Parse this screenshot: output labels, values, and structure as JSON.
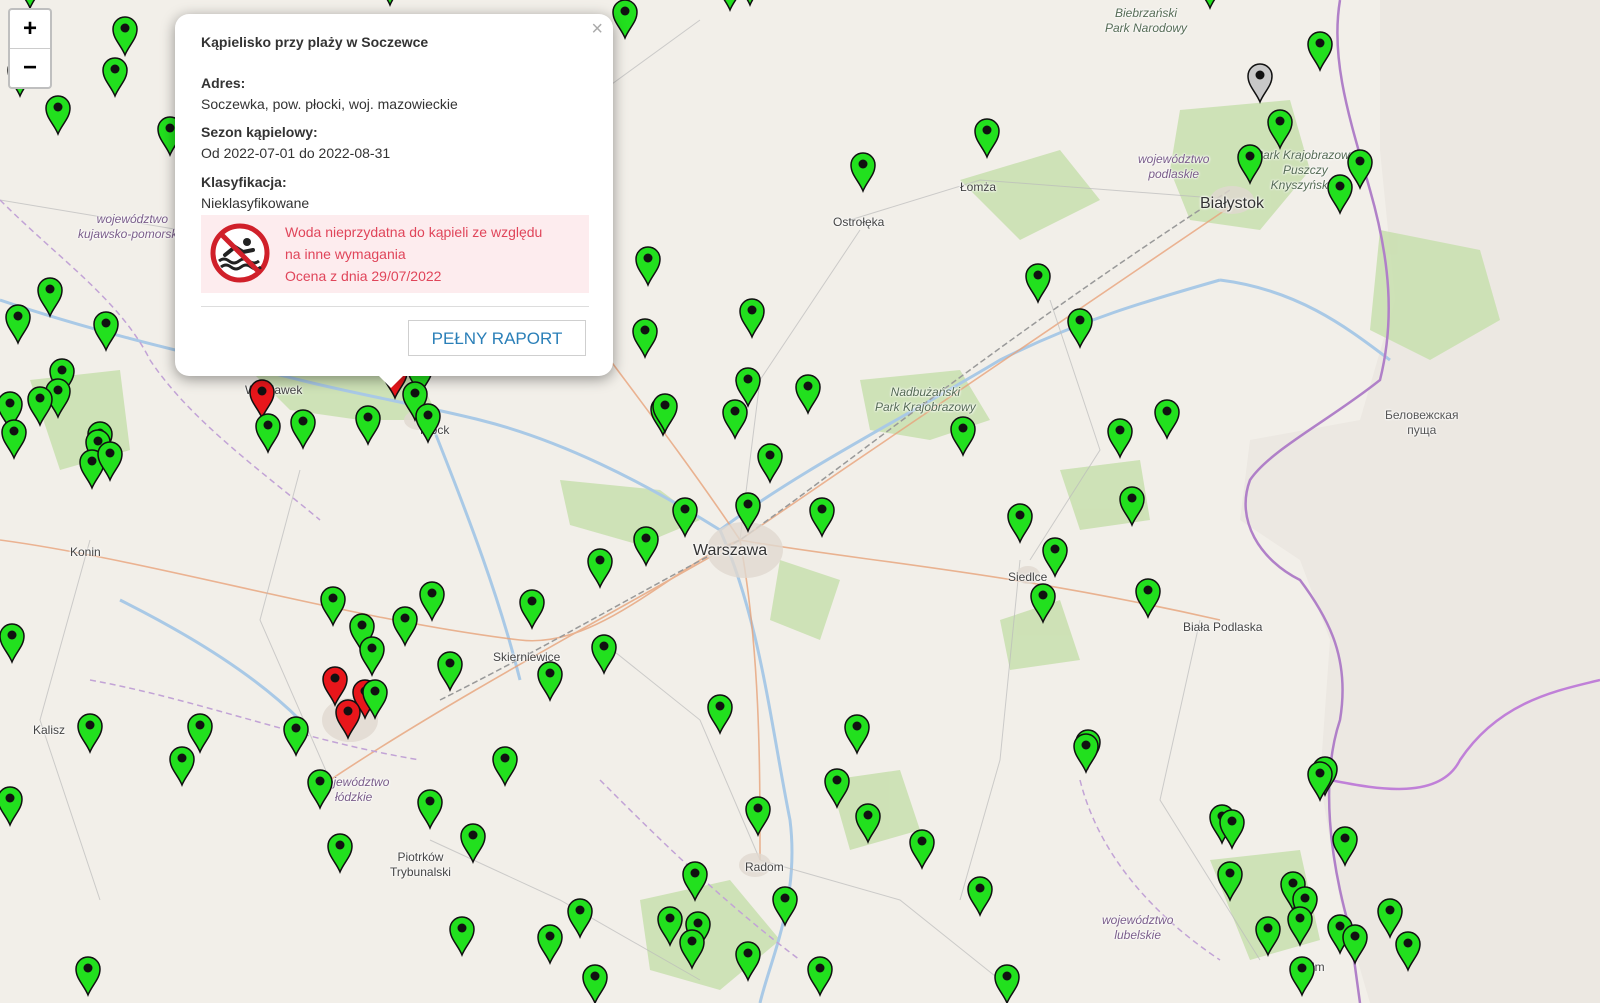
{
  "zoom": {
    "in_label": "+",
    "out_label": "−"
  },
  "popup": {
    "close_label": "×",
    "title": "Kąpielisko przy plaży w Soczewce",
    "address_label": "Adres:",
    "address_value": "Soczewka, pow. płocki, woj. mazowieckie",
    "season_label": "Sezon kąpielowy:",
    "season_value": "Od 2022-07-01 do 2022-08-31",
    "class_label": "Klasyfikacja:",
    "class_value": "Nieklasyfikowane",
    "warning_line1": "Woda nieprzydatna do kąpieli ze względu",
    "warning_line2": "na inne wymagania",
    "warning_line3": "Ocena z dnia 29/07/2022",
    "warning_icon": "no-swimming-icon",
    "report_button": "PEŁNY RAPORT"
  },
  "place_labels": {
    "biebrza_1": "Biebrzański",
    "biebrza_2": "Park Narodowy",
    "podlaskie_1": "województwo",
    "podlaskie_2": "podlaskie",
    "knysz_1": "Park Krajobrazowy",
    "knysz_2": "Puszczy",
    "knysz_3": "Knyszyńskiej",
    "bialystok": "Białystok",
    "lomza": "Łomża",
    "ostroleka": "Ostrołęka",
    "kujawsko_1": "województwo",
    "kujawsko_2": "kujawsko-pomorskie",
    "wloclawek": "Włocławek",
    "nadbuzanski_1": "Nadbużański",
    "nadbuzanski_2": "Park Krajobrazowy",
    "belowezha_1": "Беловежская",
    "belowezha_2": "пуща",
    "konin": "Konin",
    "warszawa": "Warszawa",
    "siedlce": "Siedlce",
    "skierniewice": "Skierniewice",
    "biala_podlaska": "Biała Podlaska",
    "kalisz": "Kalisz",
    "lodzkie_1": "województwo",
    "lodzkie_2": "łódzkie",
    "piotrkow_1": "Piotrków",
    "piotrkow_2": "Trybunalski",
    "radom": "Radom",
    "lubelskie_1": "województwo",
    "lubelskie_2": "lubelskie",
    "chelm": "Chełm",
    "plock": "Płock"
  },
  "markers": {
    "green_count_note": "",
    "status_colors": {
      "ok": "#22e01e",
      "bad": "#e8161b",
      "unknown": "#c8c8c8"
    }
  }
}
